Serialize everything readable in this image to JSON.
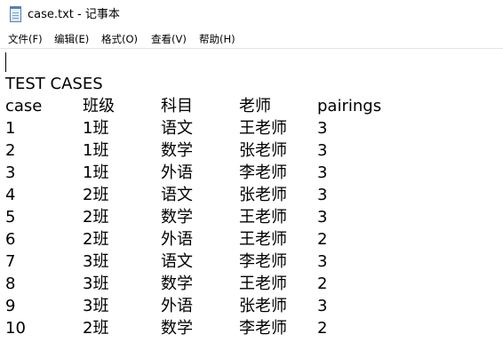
{
  "window": {
    "title": "case.txt - 记事本",
    "icon": "notepad-icon"
  },
  "menu": {
    "file": "文件(F)",
    "edit": "编辑(E)",
    "format": "格式(O)",
    "view": "查看(V)",
    "help": "帮助(H)"
  },
  "document": {
    "heading": "TEST CASES",
    "columns": [
      "case",
      "班级",
      "科目",
      "老师",
      "pairings"
    ],
    "rows": [
      [
        "1",
        "1班",
        "语文",
        "王老师",
        "3"
      ],
      [
        "2",
        "1班",
        "数学",
        "张老师",
        "3"
      ],
      [
        "3",
        "1班",
        "外语",
        "李老师",
        "3"
      ],
      [
        "4",
        "2班",
        "语文",
        "张老师",
        "3"
      ],
      [
        "5",
        "2班",
        "数学",
        "王老师",
        "3"
      ],
      [
        "6",
        "2班",
        "外语",
        "王老师",
        "2"
      ],
      [
        "7",
        "3班",
        "语文",
        "李老师",
        "3"
      ],
      [
        "8",
        "3班",
        "数学",
        "王老师",
        "2"
      ],
      [
        "9",
        "3班",
        "外语",
        "张老师",
        "3"
      ],
      [
        "10",
        "2班",
        "数学",
        "李老师",
        "2"
      ]
    ]
  }
}
